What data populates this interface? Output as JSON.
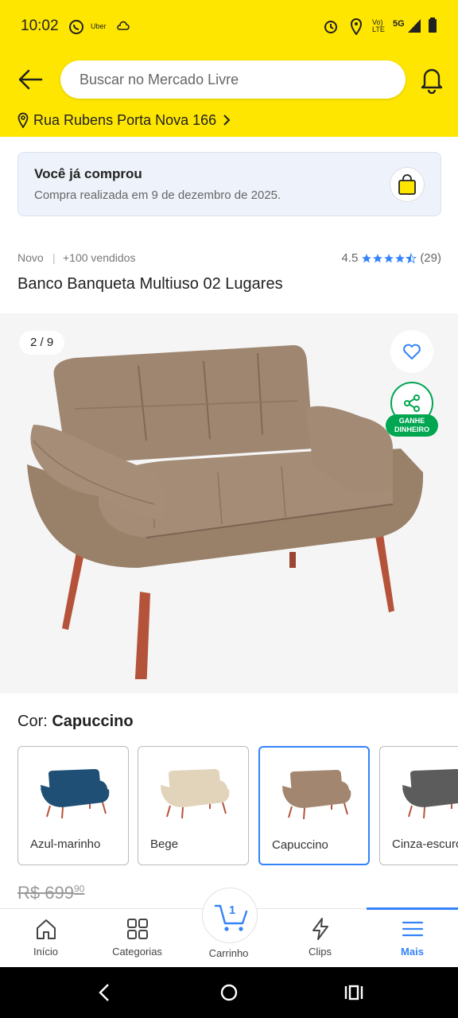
{
  "status_bar": {
    "time": "10:02",
    "uber": "Uber",
    "network": "5G",
    "volte": "Vo) LTE"
  },
  "header": {
    "search_placeholder": "Buscar no Mercado Livre",
    "address": "Rua Rubens Porta Nova 166"
  },
  "purchase_notice": {
    "title": "Você já comprou",
    "subtitle": "Compra realizada em 9 de dezembro de 2025."
  },
  "product": {
    "condition": "Novo",
    "separator": "|",
    "sold": "+100 vendidos",
    "rating": "4.5",
    "rating_value": 4.5,
    "reviews": "(29)",
    "title": "Banco Banqueta Multiuso 02 Lugares"
  },
  "gallery": {
    "counter": "2 / 9",
    "earn_badge_line1": "GANHE",
    "earn_badge_line2": "DINHEIRO"
  },
  "color": {
    "label": "Cor:",
    "selected": "Capuccino",
    "options": [
      {
        "label": "Azul-marinho",
        "hex": "#1f4f74"
      },
      {
        "label": "Bege",
        "hex": "#e2d3bb"
      },
      {
        "label": "Capuccino",
        "hex": "#a38670"
      },
      {
        "label": "Cinza-escuro",
        "hex": "#5c5c5c"
      }
    ]
  },
  "price": {
    "old_integer": "R$ 699",
    "old_cents": "90"
  },
  "tabbar": {
    "items": [
      {
        "label": "Início"
      },
      {
        "label": "Categorias"
      },
      {
        "label": "Carrinho",
        "badge": "1"
      },
      {
        "label": "Clips"
      },
      {
        "label": "Mais"
      }
    ]
  },
  "colors": {
    "yellow": "#fee600",
    "accent": "#3483fa",
    "green": "#00a650",
    "sofa": "#9c8570"
  }
}
